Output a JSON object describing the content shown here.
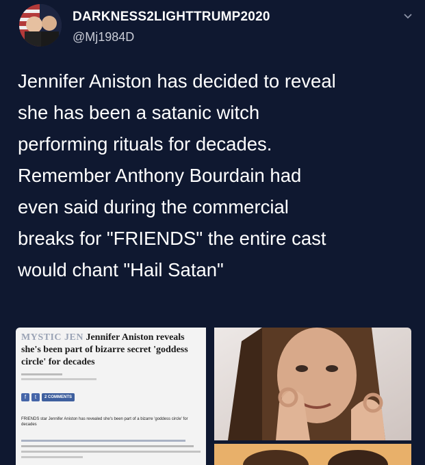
{
  "tweet": {
    "display_name": "DARKNESS2LIGHTTRUMP2020",
    "handle": "@Mj1984D",
    "text_lines": [
      "Jennifer Aniston has decided to reveal",
      "she has been a satanic witch",
      "performing rituals for decades.",
      "Remember Anthony Bourdain had",
      "even said during the commercial",
      "breaks for \"FRIENDS\" the entire cast",
      "would chant \"Hail Satan\""
    ]
  },
  "article": {
    "brand": "MYSTIC JEN",
    "headline": "Jennifer Aniston reveals she's been part of bizarre secret 'goddess circle' for decades",
    "comments_label": "2 COMMENTS",
    "caption": "FRIENDS star Jennifer Aniston has revealed she's been part of a bizarre 'goddess circle' for decades"
  },
  "icons": {
    "chevron": "chevron-down-icon",
    "share_facebook": "facebook-icon",
    "share_twitter": "twitter-icon"
  },
  "colors": {
    "background": "#0f1830",
    "text": "#ffffff",
    "handle": "#c9ccd6",
    "article_bg": "#f3f3f3",
    "share_blue": "#4565a8"
  }
}
